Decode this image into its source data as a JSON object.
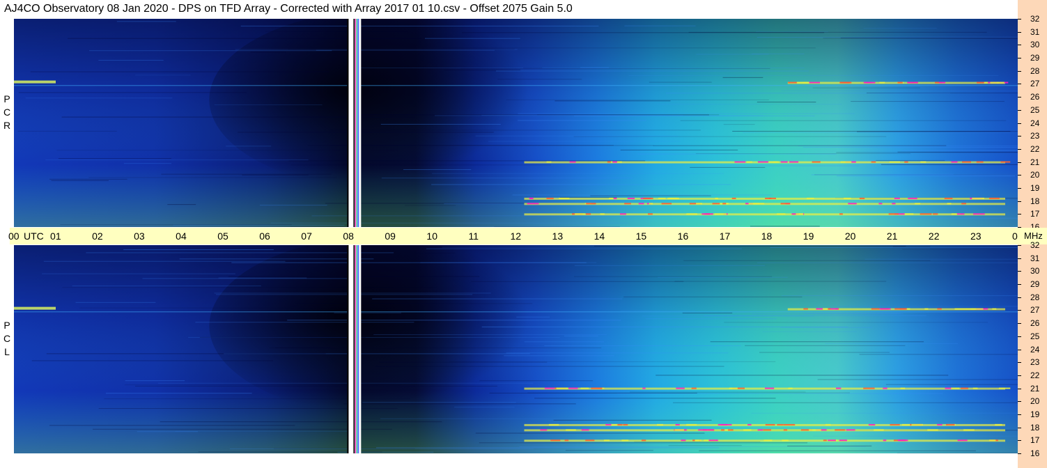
{
  "title": "AJ4CO Observatory  08 Jan 2020  -  DPS on TFD Array  -  Corrected with Array 2017 01 10.csv  -  Offset 2075  Gain 5.0",
  "chart_data": {
    "type": "heatmap",
    "x_unit": "UTC",
    "y_unit": "MHz",
    "time_ticks": [
      "00",
      "01",
      "02",
      "03",
      "04",
      "05",
      "06",
      "07",
      "08",
      "09",
      "10",
      "11",
      "12",
      "13",
      "14",
      "15",
      "16",
      "17",
      "18",
      "19",
      "20",
      "21",
      "22",
      "23",
      "00"
    ],
    "freq_ticks": [
      32,
      31,
      30,
      29,
      28,
      27,
      26,
      25,
      24,
      23,
      22,
      21,
      20,
      19,
      18,
      17,
      16
    ],
    "xlim": [
      0,
      24
    ],
    "ylim": [
      16,
      32
    ],
    "panels": [
      {
        "label": [
          "R",
          "C",
          "P"
        ],
        "gap_utc": [
          8.0,
          8.3
        ]
      },
      {
        "label": [
          "L",
          "C",
          "P"
        ],
        "gap_utc": [
          8.0,
          8.3
        ]
      }
    ],
    "colorscale": [
      "#000010",
      "#0a1a6e",
      "#1440c8",
      "#1c8ae8",
      "#22c4d8",
      "#60e8a0",
      "#e8f040",
      "#ff6030",
      "#ff20c0"
    ],
    "interference_bands_mhz": [
      27.1,
      17.8,
      17.0,
      21.0,
      18.2
    ],
    "labels": {
      "utc_label": "UTC",
      "mhz_label": "MHz"
    }
  }
}
